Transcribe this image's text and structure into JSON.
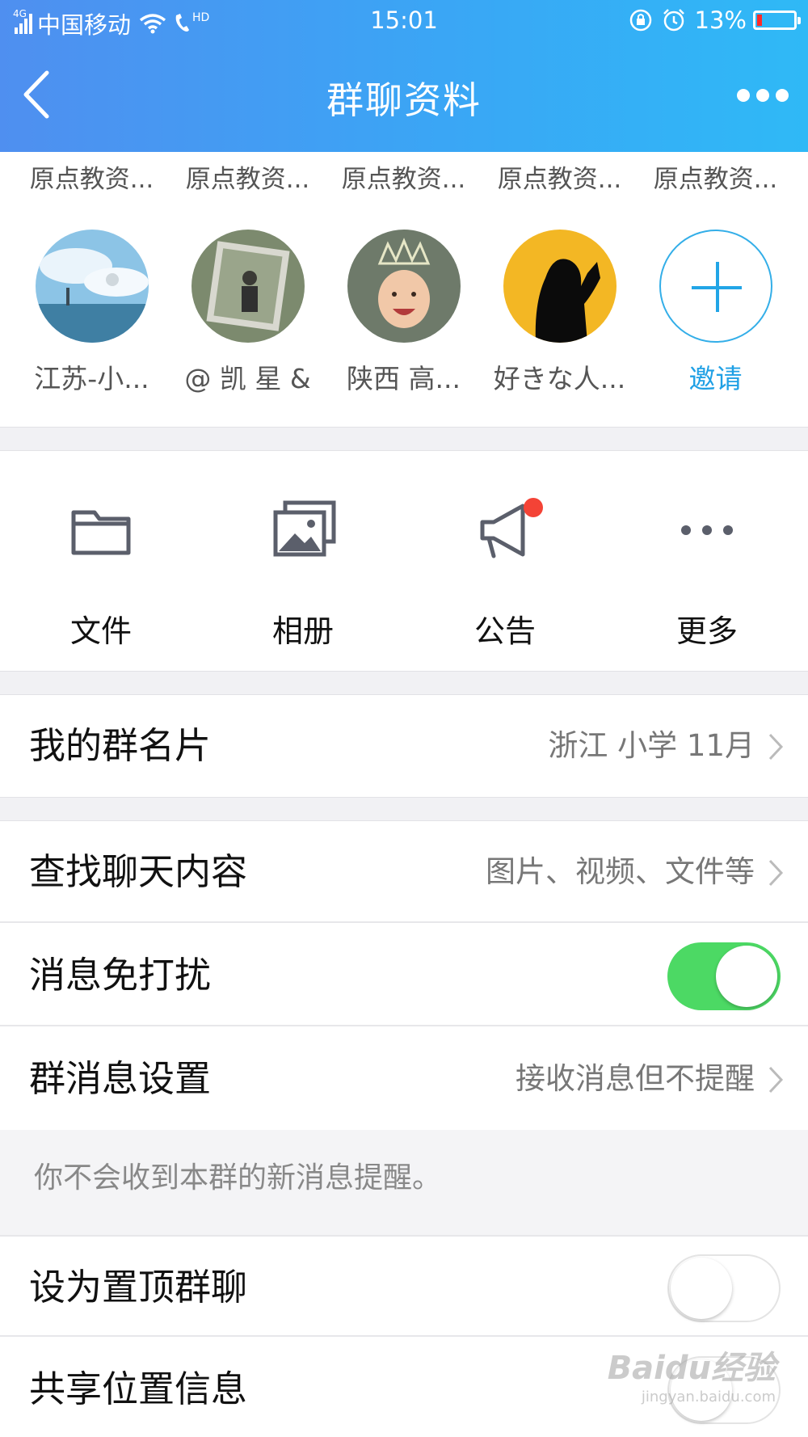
{
  "status_bar": {
    "network": "4G",
    "carrier": "中国移动",
    "hd": "HD",
    "time": "15:01",
    "battery": "13%",
    "battery_level": 0.13
  },
  "nav": {
    "title": "群聊资料"
  },
  "members_top_row": [
    "原点教资...",
    "原点教资...",
    "原点教资...",
    "原点教资...",
    "原点教资..."
  ],
  "members": [
    {
      "name": "江苏-小...",
      "avatar": "sea-lighthouse"
    },
    {
      "name": "@ 凯  星 &",
      "avatar": "person-in-photo"
    },
    {
      "name": "陕西 高...",
      "avatar": "laughing-baby"
    },
    {
      "name": "好きな人...",
      "avatar": "silhouette-yellow"
    }
  ],
  "invite_label": "邀请",
  "tools": [
    {
      "label": "文件",
      "icon": "folder-icon"
    },
    {
      "label": "相册",
      "icon": "album-icon"
    },
    {
      "label": "公告",
      "icon": "megaphone-icon",
      "badge": true
    },
    {
      "label": "更多",
      "icon": "more-dots-icon"
    }
  ],
  "settings": {
    "card": {
      "label": "我的群名片",
      "value": "浙江  小学  11月"
    },
    "search": {
      "label": "查找聊天内容",
      "value": "图片、视频、文件等"
    },
    "mute": {
      "label": "消息免打扰",
      "on": true
    },
    "msg_setting": {
      "label": "群消息设置",
      "value": "接收消息但不提醒"
    },
    "hint": "你不会收到本群的新消息提醒。",
    "pin": {
      "label": "设为置顶群聊",
      "on": false
    },
    "location": {
      "label": "共享位置信息"
    }
  },
  "watermark": {
    "brand": "Baidu经验",
    "url": "jingyan.baidu.com"
  },
  "colors": {
    "accent": "#1fa0e5",
    "toggle_on": "#4cd964",
    "badge": "#f44336"
  }
}
